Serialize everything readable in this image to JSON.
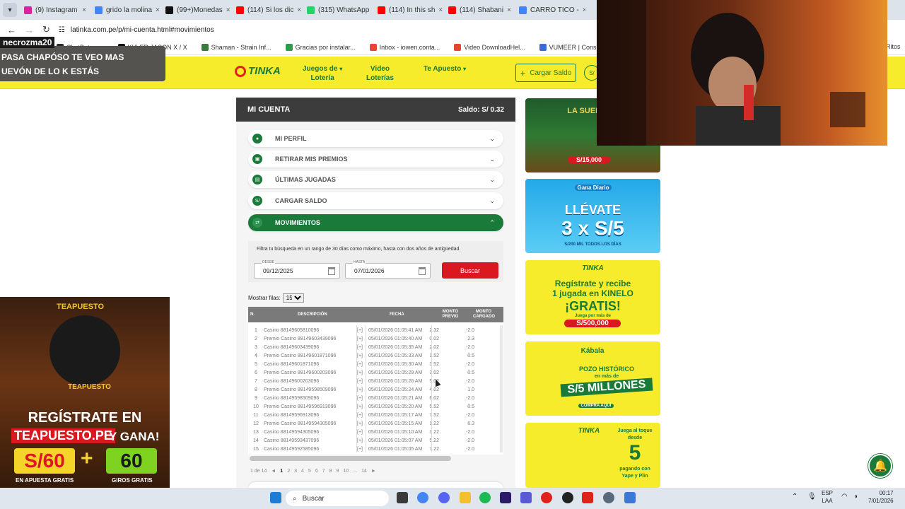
{
  "browser": {
    "tabs": [
      {
        "label": "(9) Instagram",
        "color": "#d6249f"
      },
      {
        "label": "grido la molina",
        "color": "#4285f4"
      },
      {
        "label": "(99+)Monedas",
        "color": "#111111"
      },
      {
        "label": "(114) Si los dic",
        "color": "#ff0000"
      },
      {
        "label": "(315) WhatsApp",
        "color": "#25d366"
      },
      {
        "label": "(114) In this sh",
        "color": "#ff0000"
      },
      {
        "label": "(114) Shabani",
        "color": "#ff0000"
      },
      {
        "label": "CARRO TICO -",
        "color": "#4285f4"
      }
    ],
    "url": "latinka.com.pe/p/mi-cuenta.html#movimientos",
    "bookmarks": [
      {
        "label": "ChatBot an...",
        "color": "#2a2a2a"
      },
      {
        "label": "KYLER JASON X / X",
        "color": "#111111"
      },
      {
        "label": "Shaman - Strain Inf...",
        "color": "#3a7a3a"
      },
      {
        "label": "Gracias por instalar...",
        "color": "#2a9d4a"
      },
      {
        "label": "Inbox - iowen.conta...",
        "color": "#ea4335"
      },
      {
        "label": "Video DownloadHel...",
        "color": "#e04a2a"
      },
      {
        "label": "VUMEER | Consigue...",
        "color": "#3a6ad6"
      },
      {
        "label": "- Find & Share on G...",
        "color": "#cc2222"
      }
    ],
    "bm_right": "Ritos"
  },
  "stream": {
    "username": "necrozma20",
    "chat_line1": "PASA CHAPÓSO TE VEO MAS",
    "chat_line2": "UEVÓN DE LO K ESTÁS"
  },
  "site": {
    "logo": "TINKA",
    "nav": [
      {
        "l1": "Juegos de",
        "l2": "Lotería"
      },
      {
        "l1": "Video",
        "l2": "Loterías"
      },
      {
        "l1": "Te Apuesto",
        "l2": ""
      }
    ],
    "cargar_saldo": "Cargar Saldo",
    "sol_btn": "S/"
  },
  "account": {
    "title": "MI CUENTA",
    "saldo": "Saldo: S/ 0.32",
    "sections": [
      {
        "label": "MI PERFIL",
        "icon": "user-icon"
      },
      {
        "label": "RETIRAR MIS PREMIOS",
        "icon": "bank-icon"
      },
      {
        "label": "ÚLTIMAS JUGADAS",
        "icon": "ticket-icon"
      },
      {
        "label": "CARGAR SALDO",
        "icon": "sol-icon"
      },
      {
        "label": "MOVIMIENTOS",
        "icon": "swap-icon"
      }
    ],
    "filter_help": "Filtra tu búsqueda en un rango de 30 días como máximo, hasta con dos años de antigüedad.",
    "desde_label": "DESDE",
    "desde_value": "09/12/2025",
    "hasta_label": "HASTA",
    "hasta_value": "07/01/2026",
    "buscar": "Buscar",
    "mostrar_label": "Mostrar filas:",
    "mostrar_value": "15",
    "columns": {
      "n": "N.",
      "desc": "DESCRIPCIÓN",
      "fecha": "FECHA",
      "previo1": "MONTO",
      "previo2": "PREVIO",
      "cargado1": "MONTO",
      "cargado2": "CARGADO"
    },
    "rows": [
      {
        "n": "1",
        "desc": "Casino 88149605810096",
        "plus": "[+]",
        "fecha": "05/01/2026 01:05:41 AM",
        "previo": "2.32",
        "cargado": "-2.0"
      },
      {
        "n": "2",
        "desc": "Premio Casino 88149603439096",
        "plus": "[+]",
        "fecha": "05/01/2026 01:05:40 AM",
        "previo": "0.02",
        "cargado": "2.3"
      },
      {
        "n": "3",
        "desc": "Casino 88149603439096",
        "plus": "[+]",
        "fecha": "05/01/2026 01:05:35 AM",
        "previo": "2.02",
        "cargado": "-2.0"
      },
      {
        "n": "4",
        "desc": "Premio Casino 88149601871096",
        "plus": "[+]",
        "fecha": "05/01/2026 01:05:33 AM",
        "previo": "1.52",
        "cargado": "0.5"
      },
      {
        "n": "5",
        "desc": "Casino 88149601871096",
        "plus": "[+]",
        "fecha": "05/01/2026 01:05:30 AM",
        "previo": "3.52",
        "cargado": "-2.0"
      },
      {
        "n": "6",
        "desc": "Premio Casino 88149600203096",
        "plus": "[+]",
        "fecha": "05/01/2026 01:05:29 AM",
        "previo": "3.02",
        "cargado": "0.5"
      },
      {
        "n": "7",
        "desc": "Casino 88149600203096",
        "plus": "[+]",
        "fecha": "05/01/2026 01:05:26 AM",
        "previo": "5.02",
        "cargado": "-2.0"
      },
      {
        "n": "8",
        "desc": "Premio Casino 88149598509096",
        "plus": "[+]",
        "fecha": "05/01/2026 01:05:24 AM",
        "previo": "4.02",
        "cargado": "1.0"
      },
      {
        "n": "9",
        "desc": "Casino 88149598509096",
        "plus": "[+]",
        "fecha": "05/01/2026 01:05:21 AM",
        "previo": "6.02",
        "cargado": "-2.0"
      },
      {
        "n": "10",
        "desc": "Premio Casino 88149596913096",
        "plus": "[+]",
        "fecha": "05/01/2026 01:05:20 AM",
        "previo": "5.52",
        "cargado": "0.5"
      },
      {
        "n": "11",
        "desc": "Casino 88149596913096",
        "plus": "[+]",
        "fecha": "05/01/2026 01:05:17 AM",
        "previo": "7.52",
        "cargado": "-2.0"
      },
      {
        "n": "12",
        "desc": "Premio Casino 88149594305096",
        "plus": "[+]",
        "fecha": "05/01/2026 01:05:15 AM",
        "previo": "1.22",
        "cargado": "6.3"
      },
      {
        "n": "13",
        "desc": "Casino 88149594305096",
        "plus": "[+]",
        "fecha": "05/01/2026 01:05:10 AM",
        "previo": "3.22",
        "cargado": "-2.0"
      },
      {
        "n": "14",
        "desc": "Casino 88149593437096",
        "plus": "[+]",
        "fecha": "05/01/2026 01:05:07 AM",
        "previo": "5.22",
        "cargado": "-2.0"
      },
      {
        "n": "15",
        "desc": "Casino 88149592585096",
        "plus": "[+]",
        "fecha": "05/01/2026 01:05:05 AM",
        "previo": "7.22",
        "cargado": "-2.0"
      }
    ],
    "pager": {
      "info": "1 de 14",
      "prev": "◄",
      "pages": [
        "1",
        "2",
        "3",
        "4",
        "5",
        "6",
        "7",
        "8",
        "9",
        "10"
      ],
      "ellipsis": "...",
      "last": "14",
      "next": "►"
    }
  },
  "ads": {
    "ad1": {
      "line1": "LA SUERTE A",
      "line2": "S/15,000"
    },
    "ad2": {
      "brand": "Gana Diario",
      "line1": "LLÉVATE",
      "line2": "3 x S/5",
      "line3": "S/200 MIL TODOS LOS DÍAS"
    },
    "ad3": {
      "brand": "TINKA",
      "line1": "Regístrate y recibe",
      "line2": "1 jugada en KINELO",
      "line3": "¡GRATIS!",
      "line4": "Juega por más de",
      "line5": "S/500,000"
    },
    "ad4": {
      "brand": "Kábala",
      "line1": "POZO HISTÓRICO",
      "line2": "en más de",
      "line3": "S/5 MILLONES",
      "line4": "COMPRA AQUÍ"
    },
    "ad5": {
      "brand": "TINKA",
      "line1": "Juega al toque",
      "line2": "desde",
      "line3": "5",
      "line4": "pagando con",
      "line5": "Yape y Plin"
    }
  },
  "left_banner": {
    "brand": "TEAPUESTO",
    "brand2": "TEAPUESTO",
    "line1": "REGÍSTRATE EN",
    "line2": "TEAPUESTO.PE",
    "line2b": "Y GANA!",
    "amount1": "S/60",
    "plus": "+",
    "amount2": "60",
    "sub1": "EN APUESTA GRATIS",
    "sub2": "GIROS GRATIS"
  },
  "taskbar": {
    "search": "Buscar",
    "lang1": "ESP",
    "lang2": "LAA",
    "time": "00:17",
    "date": "7/01/2026"
  }
}
